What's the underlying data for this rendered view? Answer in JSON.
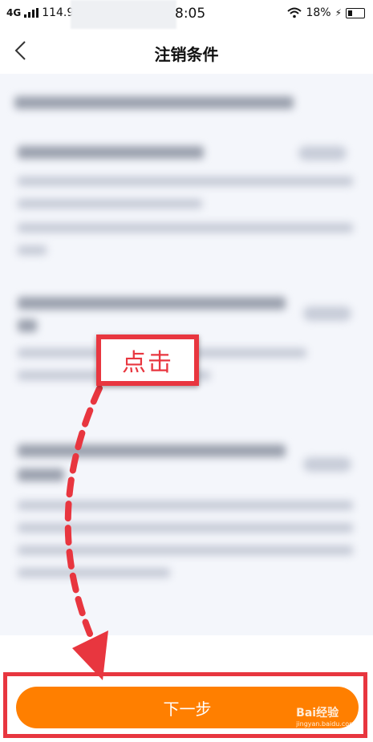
{
  "status_bar": {
    "network": "4G",
    "carrier_partial": "114.9",
    "time": "8:05",
    "battery": "18%"
  },
  "header": {
    "title": "注销条件"
  },
  "callout": {
    "text": "点击"
  },
  "footer": {
    "next_label": "下一步"
  },
  "watermark": {
    "text": "Bai经验",
    "sub": "jingyan.baidu.com"
  },
  "colors": {
    "accent": "#ff7f00",
    "annotation": "#e8363f"
  }
}
